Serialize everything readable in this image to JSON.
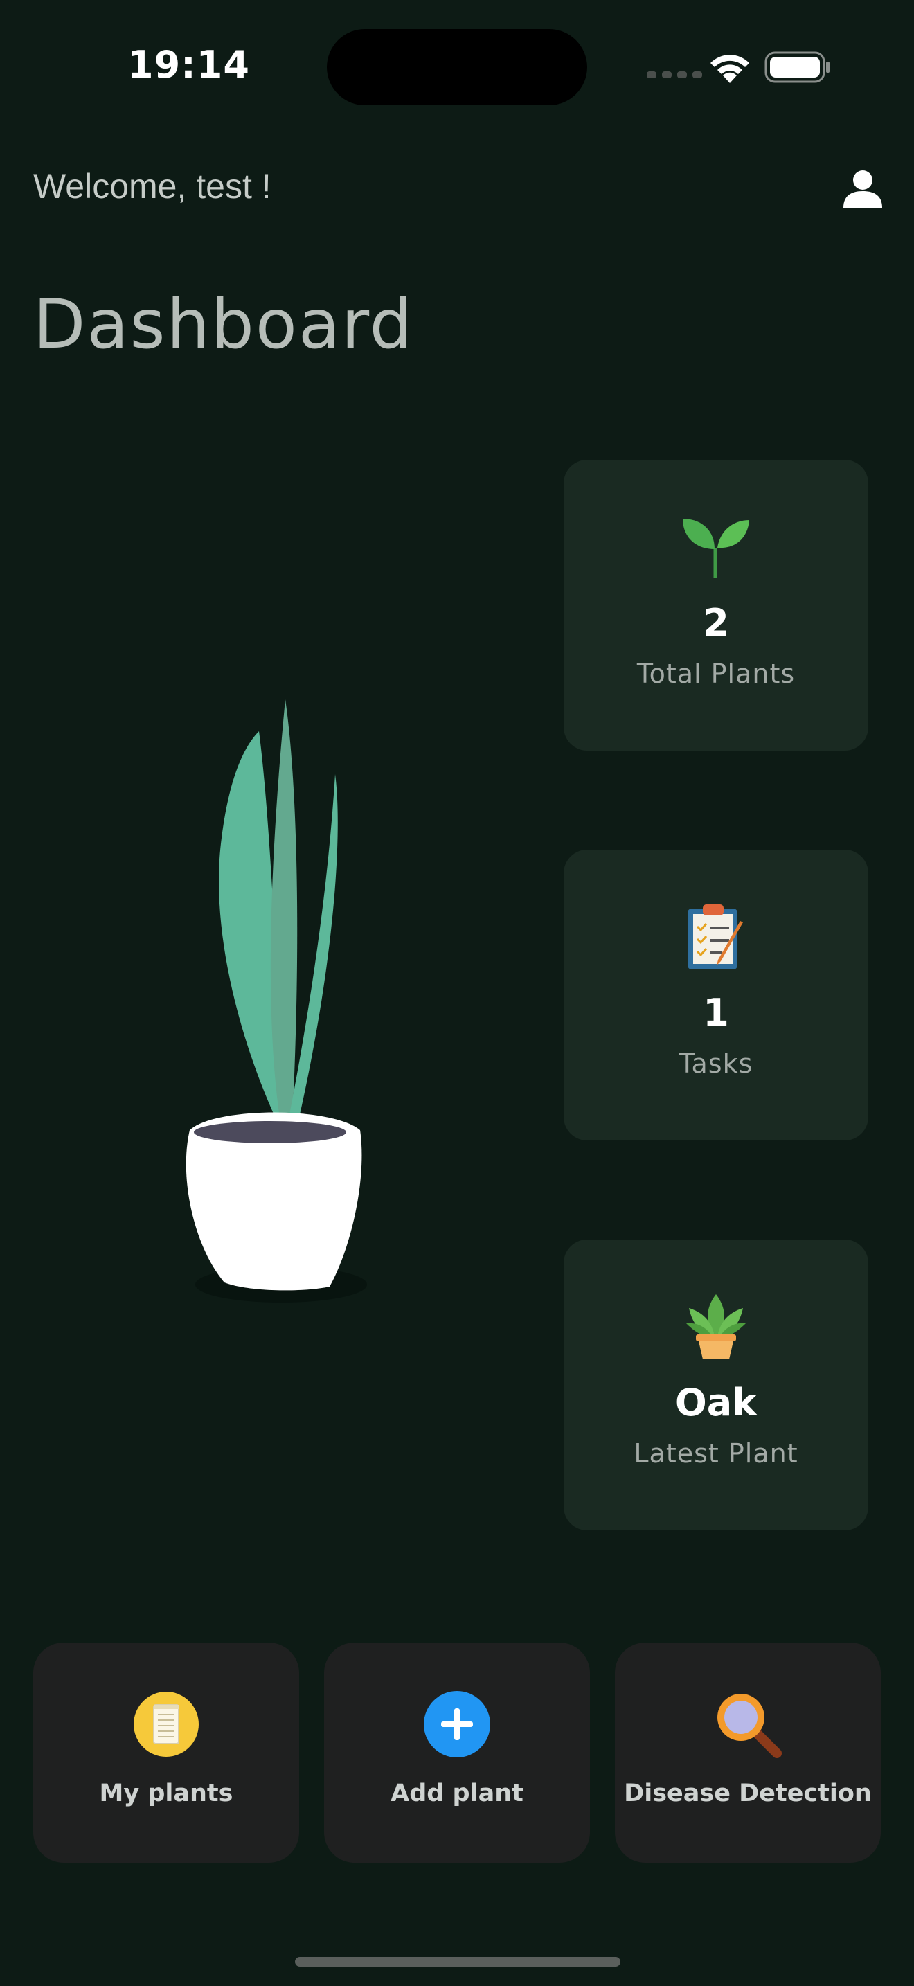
{
  "status_bar": {
    "time": "19:14"
  },
  "header": {
    "welcome": "Welcome, test !",
    "title": "Dashboard"
  },
  "stats": [
    {
      "value": "2",
      "label": "Total Plants",
      "icon": "seedling-icon"
    },
    {
      "value": "1",
      "label": "Tasks",
      "icon": "clipboard-icon"
    },
    {
      "value": "Oak",
      "label": "Latest Plant",
      "icon": "potted-plant-icon"
    }
  ],
  "actions": [
    {
      "label": "My plants",
      "icon": "notepad-icon"
    },
    {
      "label": "Add plant",
      "icon": "add-icon",
      "color": "#2196f3"
    },
    {
      "label": "Disease Detection",
      "icon": "magnifier-icon"
    }
  ],
  "colors": {
    "background": "#0d1b15",
    "card": "#1a2a22",
    "action_card": "#1f2020",
    "accent": "#2196f3"
  }
}
